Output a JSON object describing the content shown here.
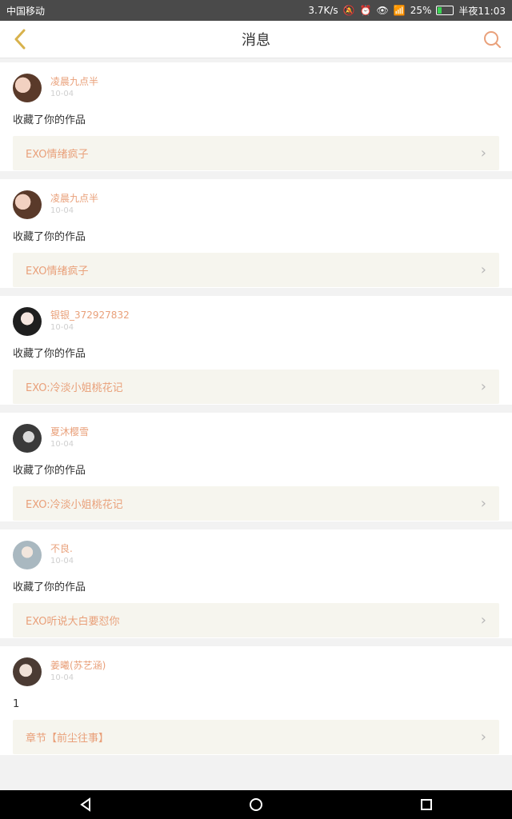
{
  "status_bar": {
    "carrier": "中国移动",
    "speed": "3.7K/s",
    "battery": "25%",
    "time": "半夜11:03"
  },
  "header": {
    "title": "消息",
    "accent_color": "#e9a07a"
  },
  "messages": [
    {
      "username": "凌晨九点半",
      "time": "10-04",
      "text": "收藏了你的作品",
      "work_title": "EXO情绪疯子",
      "avatar_color": "#5a3a2a"
    },
    {
      "username": "凌晨九点半",
      "time": "10-04",
      "text": "收藏了你的作品",
      "work_title": "EXO情绪疯子",
      "avatar_color": "#5a3a2a"
    },
    {
      "username": "银银_372927832",
      "time": "10-04",
      "text": "收藏了你的作品",
      "work_title": "EXO:冷淡小姐桃花记",
      "avatar_color": "#1f1f1f"
    },
    {
      "username": "夏沐樱雪",
      "time": "10-04",
      "text": "收藏了你的作品",
      "work_title": "EXO:冷淡小姐桃花记",
      "avatar_color": "#3a3a3a"
    },
    {
      "username": "不良.",
      "time": "10-04",
      "text": "收藏了你的作品",
      "work_title": "EXO听说大白要怼你",
      "avatar_color": "#a9b8c0"
    },
    {
      "username": "姜曦(苏艺涵)",
      "time": "10-04",
      "text": "1",
      "work_title": "章节【前尘往事】",
      "avatar_color": "#4b3b33"
    }
  ]
}
